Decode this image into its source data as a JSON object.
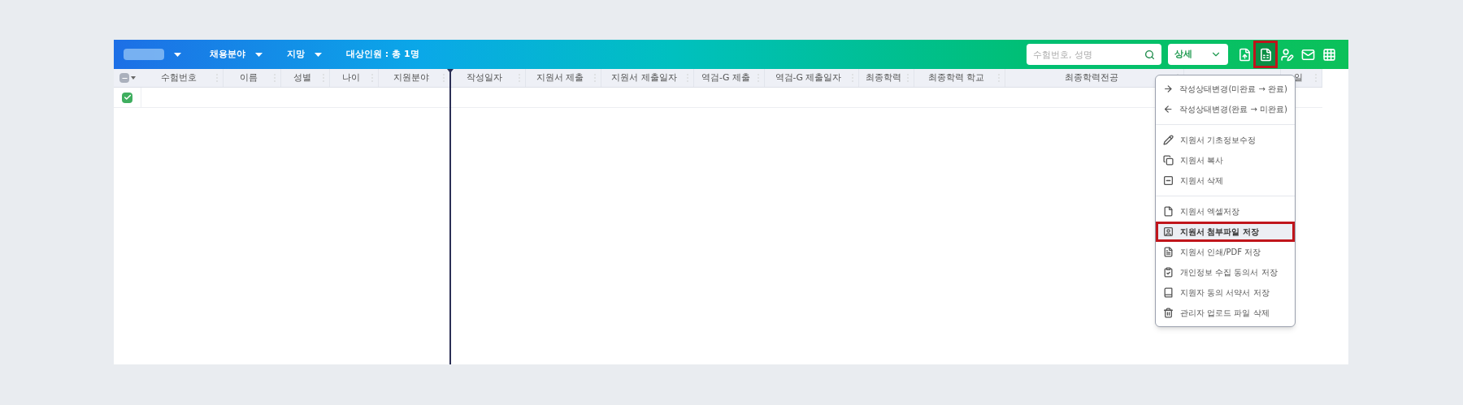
{
  "toolbar": {
    "filters": [
      {
        "label": "채용분야"
      },
      {
        "label": "지망"
      }
    ],
    "target_count": "대상인원 : 총 1명",
    "search": {
      "placeholder": "수험번호, 성명"
    },
    "view_select": {
      "value": "상세"
    },
    "actions": [
      {
        "selected": false
      },
      {
        "selected": true,
        "highlighted": true
      },
      {
        "selected": false
      },
      {
        "selected": false
      },
      {
        "selected": false
      }
    ]
  },
  "table": {
    "header_checkbox": {
      "indeterminate": true
    },
    "columns": [
      {
        "label": "수험번호"
      },
      {
        "label": "이름"
      },
      {
        "label": "성별"
      },
      {
        "label": "나이"
      },
      {
        "label": "지원분야"
      },
      {
        "label": "작성일자"
      },
      {
        "label": "지원서 제출"
      },
      {
        "label": "지원서 제출일자"
      },
      {
        "label": "역검-G 제출"
      },
      {
        "label": "역검-G 제출일자"
      },
      {
        "label": "최종학력"
      },
      {
        "label": "최종학력 학교"
      },
      {
        "label": "최종학력전공"
      },
      {
        "label": "일"
      }
    ],
    "rows": [
      {
        "checked": true
      }
    ]
  },
  "menu": {
    "sections": [
      [
        {
          "label": "작성상태변경(미완료 → 완료)",
          "highlighted": false
        },
        {
          "label": "작성상태변경(완료 → 미완료)",
          "highlighted": false
        }
      ],
      [
        {
          "label": "지원서 기초정보수정",
          "highlighted": false
        },
        {
          "label": "지원서 복사",
          "highlighted": false
        },
        {
          "label": "지원서 삭제",
          "highlighted": false
        }
      ],
      [
        {
          "label": "지원서 엑셀저장",
          "highlighted": false
        },
        {
          "label": "지원서 첨부파일 저장",
          "highlighted": true
        },
        {
          "label": "지원서 인쇄/PDF 저장",
          "highlighted": false
        },
        {
          "label": "개인정보 수집 동의서 저장",
          "highlighted": false
        },
        {
          "label": "지원자 동의 서약서 저장",
          "highlighted": false
        },
        {
          "label": "관리자 업로드 파일 삭제",
          "highlighted": false
        }
      ]
    ]
  }
}
